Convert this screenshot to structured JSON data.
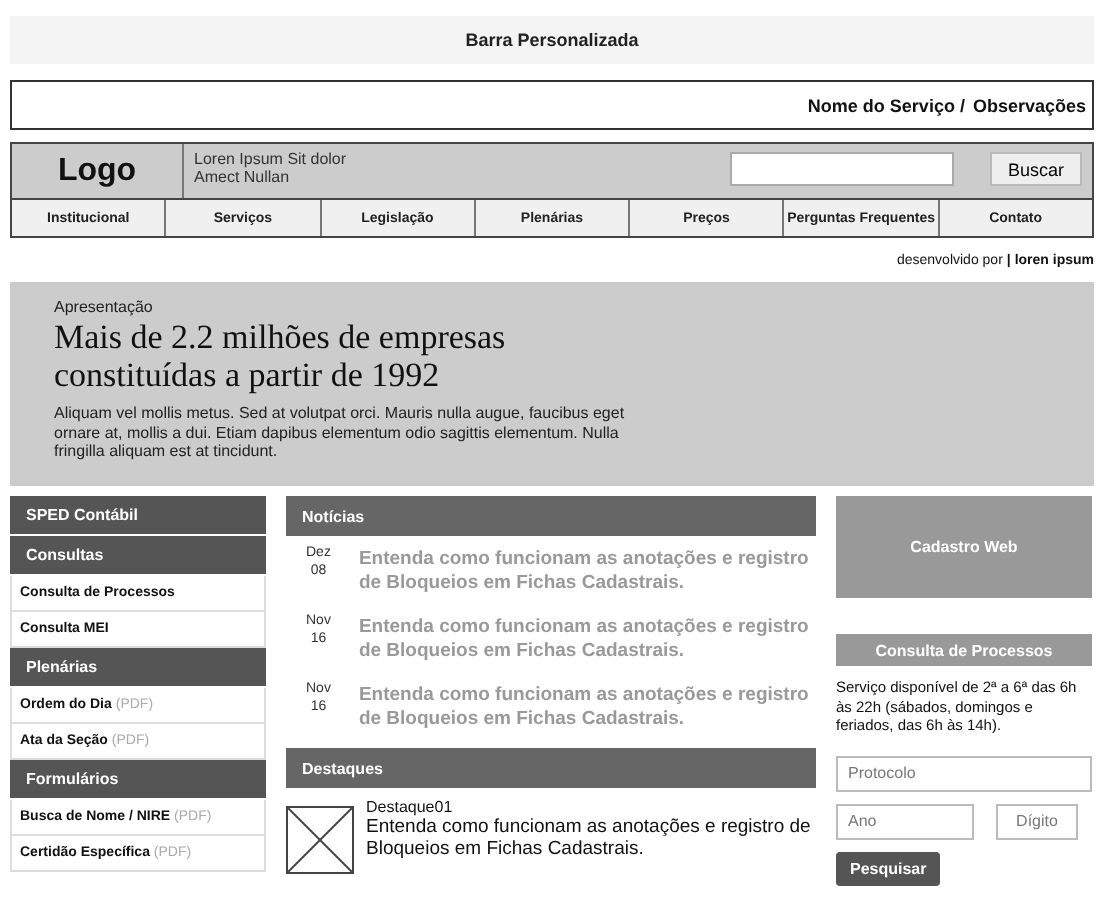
{
  "top_bar": {
    "title": "Barra Personalizada"
  },
  "service_bar": {
    "service": "Nome do Serviço /",
    "notes": "Observações"
  },
  "header": {
    "logo": "Logo",
    "tagline": [
      "Loren Ipsum Sit dolor",
      "Amect Nullan"
    ],
    "search_button": "Buscar"
  },
  "nav": [
    {
      "label": "Institucional"
    },
    {
      "label": "Serviços"
    },
    {
      "label": "Legislação"
    },
    {
      "label": "Plenárias"
    },
    {
      "label": "Preços"
    },
    {
      "label": "Perguntas Frequentes"
    },
    {
      "label": "Contato"
    }
  ],
  "credit": {
    "prefix": "desenvolvido por",
    "link": "| loren ipsum"
  },
  "hero": {
    "label": "Apresentação",
    "title": "Mais de 2.2 milhões de empresas constituídas a partir de 1992",
    "body": "Aliquam vel mollis metus. Sed at volutpat orci. Mauris nulla augue, faucibus eget ornare at, mollis a dui. Etiam dapibus elementum odio sagittis elementum. Nulla fringilla aliquam est at tincidunt."
  },
  "sidebar": [
    {
      "kind": "header",
      "label": "SPED Contábil"
    },
    {
      "kind": "header",
      "label": "Consultas"
    },
    {
      "kind": "link",
      "label": "Consulta de Processos"
    },
    {
      "kind": "link",
      "label": "Consulta MEI"
    },
    {
      "kind": "header",
      "label": "Plenárias"
    },
    {
      "kind": "link",
      "label": "Ordem do Dia",
      "suffix": "(PDF)"
    },
    {
      "kind": "link",
      "label": "Ata da Seção",
      "suffix": "(PDF)"
    },
    {
      "kind": "header",
      "label": "Formulários"
    },
    {
      "kind": "link",
      "label": "Busca de Nome / NIRE",
      "suffix": "(PDF)"
    },
    {
      "kind": "link",
      "label": "Certidão Específica",
      "suffix": "(PDF)"
    }
  ],
  "news": {
    "title": "Notícias",
    "items": [
      {
        "month": "Dez",
        "day": "08",
        "text": "Entenda como funcionam as anotações e registro de Bloqueios em Fichas Cadastrais."
      },
      {
        "month": "Nov",
        "day": "16",
        "text": "Entenda como funcionam as anotações e registro de Bloqueios em Fichas Cadastrais."
      },
      {
        "month": "Nov",
        "day": "16",
        "text": "Entenda como funcionam as anotações e registro de Bloqueios em Fichas Cadastrais."
      }
    ]
  },
  "highlights": {
    "title": "Destaques",
    "items": [
      {
        "title": "Destaque01",
        "text": "Entenda como funcionam as anotações e registro de Bloqueios em Fichas Cadastrais."
      }
    ]
  },
  "cadastro": {
    "label": "Cadastro Web"
  },
  "consulta": {
    "title": "Consulta de Processos",
    "description": "Serviço disponível de 2ª a 6ª das 6h às 22h (sábados, domingos e feriados, das 6h às 14h).",
    "protocol_placeholder": "Protocolo",
    "year_placeholder": "Ano",
    "digit_placeholder": "Dígito",
    "button": "Pesquisar"
  }
}
